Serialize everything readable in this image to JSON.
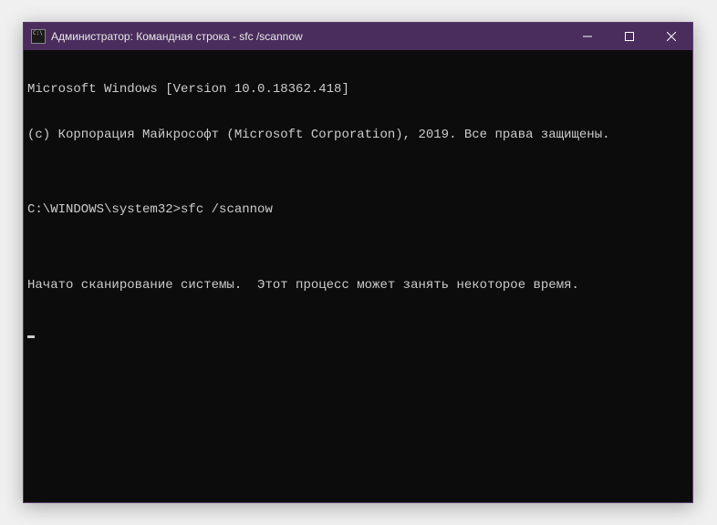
{
  "window": {
    "title": "Администратор: Командная строка - sfc  /scannow"
  },
  "terminal": {
    "line1": "Microsoft Windows [Version 10.0.18362.418]",
    "line2": "(c) Корпорация Майкрософт (Microsoft Corporation), 2019. Все права защищены.",
    "blank1": "",
    "prompt": "C:\\WINDOWS\\system32>",
    "command": "sfc /scannow",
    "blank2": "",
    "status": "Начато сканирование системы.  Этот процесс может занять некоторое время."
  }
}
